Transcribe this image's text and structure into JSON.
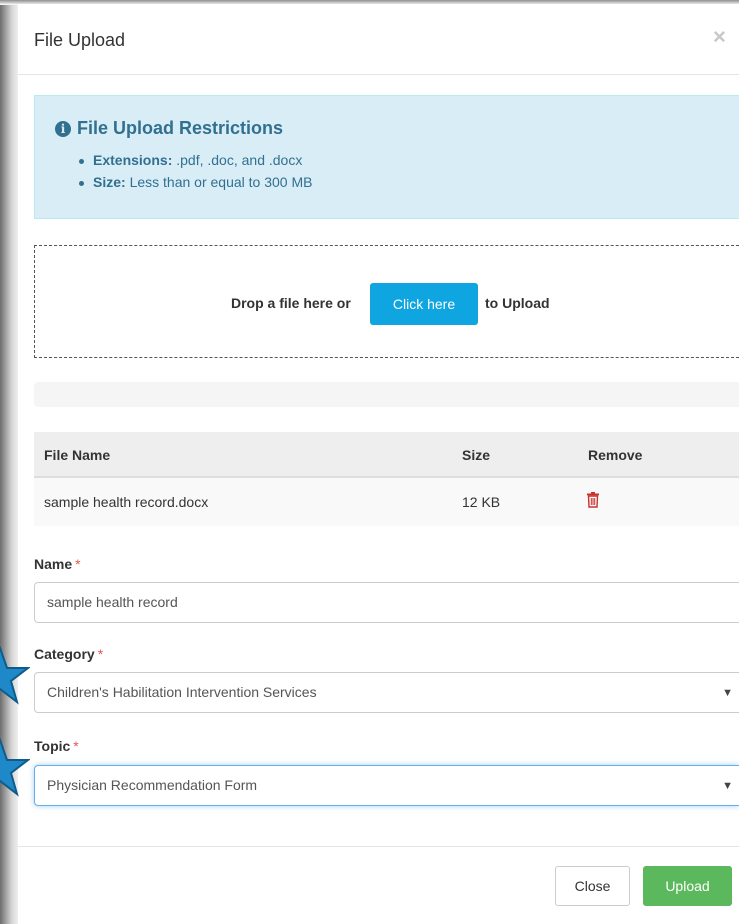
{
  "modal": {
    "title": "File Upload",
    "close_icon": "close-icon"
  },
  "restrictions": {
    "title": "File Upload Restrictions",
    "icon": "info-circle-icon",
    "items": [
      {
        "label": "Extensions:",
        "value": ".pdf, .doc, and .docx"
      },
      {
        "label": "Size:",
        "value": "Less than or equal to 300 MB"
      }
    ]
  },
  "dropzone": {
    "text_before": "Drop a file here or",
    "button_label": "Click here",
    "text_after": "to Upload"
  },
  "table": {
    "headers": [
      "File Name",
      "Size",
      "Remove"
    ],
    "rows": [
      {
        "file_name": "sample health record.docx",
        "size": "12 KB",
        "remove_icon": "trash-icon"
      }
    ]
  },
  "form": {
    "name_label": "Name",
    "name_value": "sample health record",
    "category_label": "Category",
    "category_value": "Children's Habilitation Intervention Services",
    "topic_label": "Topic",
    "topic_value": "Physician Recommendation Form",
    "required_mark": "*"
  },
  "footer": {
    "close_label": "Close",
    "upload_label": "Upload"
  },
  "colors": {
    "info_bg": "#d9edf7",
    "info_text": "#31708f",
    "primary_button": "#0ea5e0",
    "success_button": "#5cb85c",
    "required": "#e2574c",
    "star_marker": "#1e88c9"
  }
}
